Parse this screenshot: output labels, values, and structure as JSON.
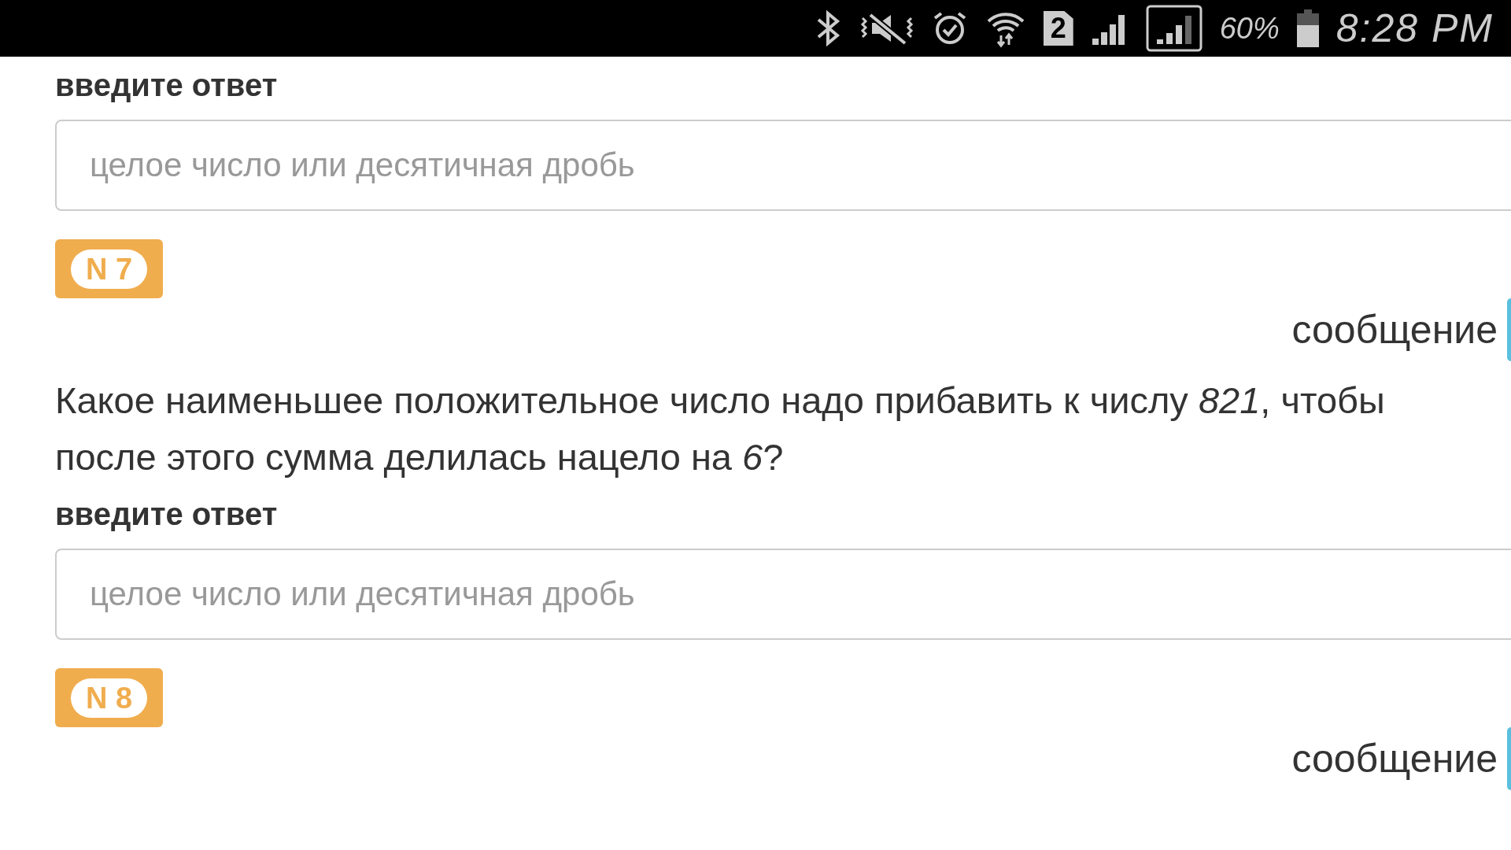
{
  "status_bar": {
    "sim_slot": "2",
    "battery_percent": "60%",
    "time": "8:28 PM"
  },
  "top_answer": {
    "label": "введите ответ",
    "placeholder": "целое число или десятичная дробь"
  },
  "tasks": [
    {
      "badge": "N 7",
      "message_label": "сообщение",
      "question": "Какое наименьшее положительное число надо прибавить к числу *821*, чтобы после этого сумма делилась нацело на *6*?",
      "answer": {
        "label": "введите ответ",
        "placeholder": "целое число или десятичная дробь"
      }
    },
    {
      "badge": "N 8",
      "message_label": "сообщение"
    }
  ]
}
